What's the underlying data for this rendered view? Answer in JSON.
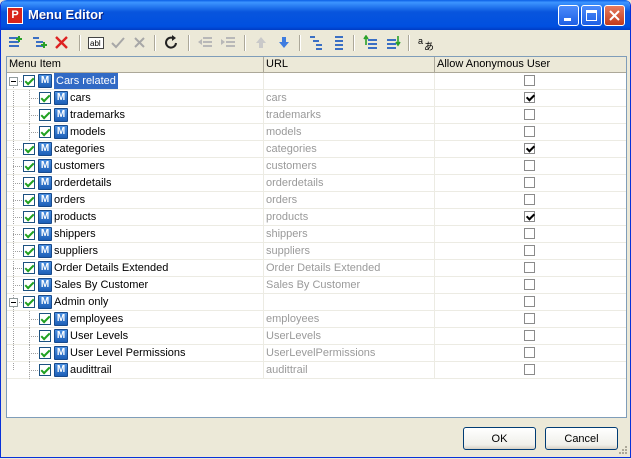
{
  "window": {
    "title": "Menu Editor",
    "app_icon_letter": "P"
  },
  "toolbar": {
    "buttons": [
      {
        "name": "add-item-icon",
        "enabled": true
      },
      {
        "name": "add-subitem-icon",
        "enabled": true
      },
      {
        "name": "delete-icon",
        "enabled": true
      },
      {
        "name": "rename-icon",
        "enabled": true,
        "label": "abl"
      },
      {
        "name": "apply-icon",
        "enabled": false
      },
      {
        "name": "cancel-edit-icon",
        "enabled": false
      },
      {
        "name": "refresh-icon",
        "enabled": true
      },
      {
        "name": "indent-left-icon",
        "enabled": false
      },
      {
        "name": "indent-right-icon",
        "enabled": false
      },
      {
        "name": "move-up-icon",
        "enabled": false
      },
      {
        "name": "move-down-icon",
        "enabled": true
      },
      {
        "name": "collapse-all-icon",
        "enabled": true
      },
      {
        "name": "expand-all-icon",
        "enabled": true
      },
      {
        "name": "import-icon",
        "enabled": true
      },
      {
        "name": "export-icon",
        "enabled": true
      },
      {
        "name": "localize-icon",
        "enabled": true,
        "label": "a"
      }
    ]
  },
  "grid": {
    "columns": [
      "Menu Item",
      "URL",
      "Allow Anonymous User"
    ],
    "rows": [
      {
        "label": "Cars related",
        "url": "",
        "anonymous": false,
        "level": 0,
        "group": true,
        "selected": true
      },
      {
        "label": "cars",
        "url": "cars",
        "anonymous": true,
        "level": 1,
        "group": false,
        "selected": false
      },
      {
        "label": "trademarks",
        "url": "trademarks",
        "anonymous": false,
        "level": 1,
        "group": false,
        "selected": false
      },
      {
        "label": "models",
        "url": "models",
        "anonymous": false,
        "level": 1,
        "group": false,
        "selected": false
      },
      {
        "label": "categories",
        "url": "categories",
        "anonymous": true,
        "level": 0,
        "group": false,
        "selected": false
      },
      {
        "label": "customers",
        "url": "customers",
        "anonymous": false,
        "level": 0,
        "group": false,
        "selected": false
      },
      {
        "label": "orderdetails",
        "url": "orderdetails",
        "anonymous": false,
        "level": 0,
        "group": false,
        "selected": false
      },
      {
        "label": "orders",
        "url": "orders",
        "anonymous": false,
        "level": 0,
        "group": false,
        "selected": false
      },
      {
        "label": "products",
        "url": "products",
        "anonymous": true,
        "level": 0,
        "group": false,
        "selected": false
      },
      {
        "label": "shippers",
        "url": "shippers",
        "anonymous": false,
        "level": 0,
        "group": false,
        "selected": false
      },
      {
        "label": "suppliers",
        "url": "suppliers",
        "anonymous": false,
        "level": 0,
        "group": false,
        "selected": false
      },
      {
        "label": "Order Details Extended",
        "url": "Order Details Extended",
        "anonymous": false,
        "level": 0,
        "group": false,
        "selected": false
      },
      {
        "label": "Sales By Customer",
        "url": "Sales By Customer",
        "anonymous": false,
        "level": 0,
        "group": false,
        "selected": false
      },
      {
        "label": "Admin only",
        "url": "",
        "anonymous": false,
        "level": 0,
        "group": true,
        "selected": false
      },
      {
        "label": "employees",
        "url": "employees",
        "anonymous": false,
        "level": 1,
        "group": false,
        "selected": false
      },
      {
        "label": "User Levels",
        "url": "UserLevels",
        "anonymous": false,
        "level": 1,
        "group": false,
        "selected": false
      },
      {
        "label": "User Level Permissions",
        "url": "UserLevelPermissions",
        "anonymous": false,
        "level": 1,
        "group": false,
        "selected": false
      },
      {
        "label": "audittrail",
        "url": "audittrail",
        "anonymous": false,
        "level": 1,
        "group": false,
        "selected": false
      }
    ]
  },
  "footer": {
    "ok_label": "OK",
    "cancel_label": "Cancel"
  },
  "colors": {
    "title_bar": "#0055e5",
    "selection": "#316ac5",
    "url_text": "#9a9a9a"
  }
}
